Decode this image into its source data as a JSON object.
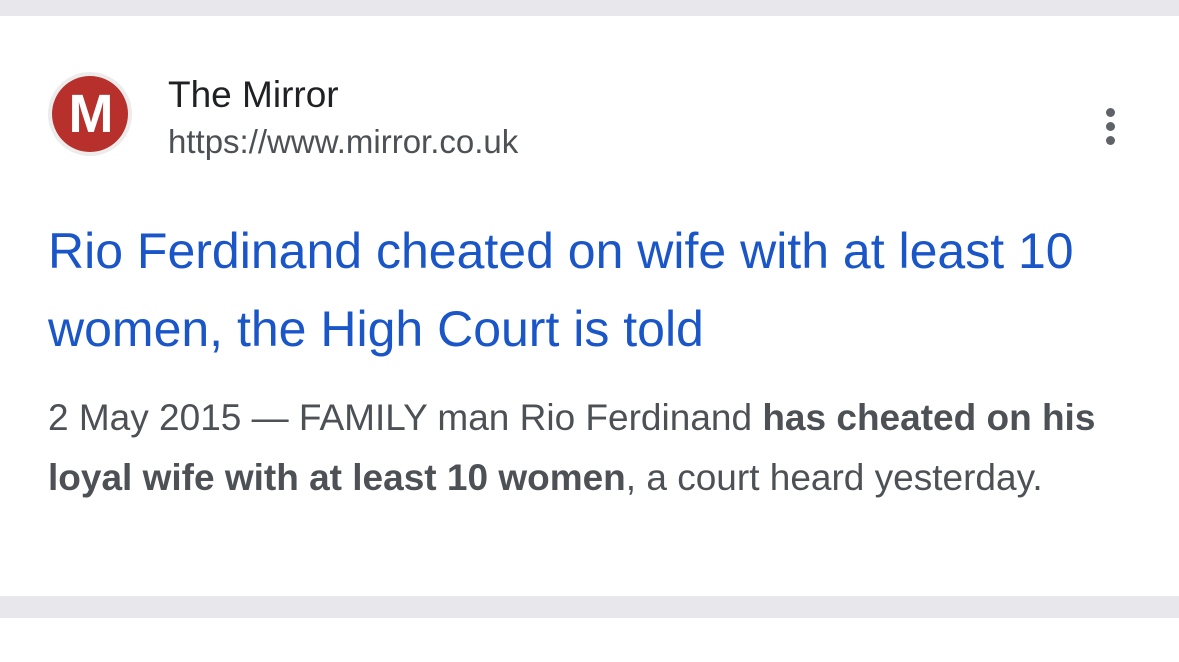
{
  "source": {
    "name": "The Mirror",
    "url": "https://www.mirror.co.uk",
    "favicon_letter": "M",
    "favicon_color": "#b7302b"
  },
  "result": {
    "title": "Rio Ferdinand cheated on wife with at least 10 women, the High Court is told",
    "date": "2 May 2015",
    "separator": " — ",
    "snippet_part1": "FAMILY man Rio Ferdinand ",
    "snippet_bold1": "has cheated on his loyal wife with at least 10 women",
    "snippet_part2": ", a court heard yesterday."
  },
  "menu": {
    "icon": "more-vert-icon"
  },
  "colors": {
    "title_link": "#1a56c8",
    "snippet_text": "#4d5156",
    "band": "#e8e8ec"
  }
}
